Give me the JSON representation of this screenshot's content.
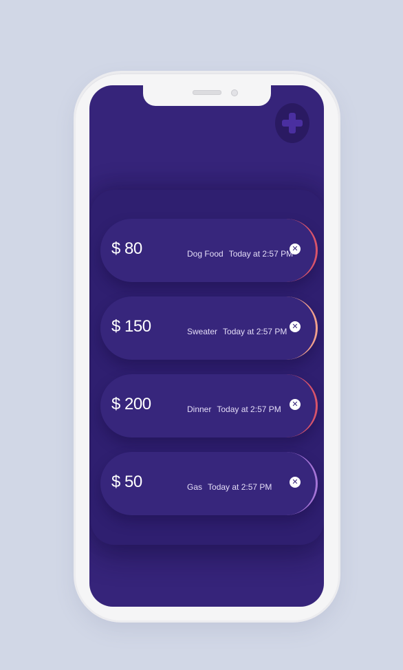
{
  "header": {
    "add_icon": "plus-icon"
  },
  "expenses": [
    {
      "amount": "$ 80",
      "description": "Dog Food",
      "time": "Today at 2:57 PM",
      "accent_color": "#d9546a",
      "remove_icon": "close-icon"
    },
    {
      "amount": "$ 150",
      "description": "Sweater",
      "time": "Today at 2:57 PM",
      "accent_color": "#f0a08c",
      "remove_icon": "close-icon"
    },
    {
      "amount": "$ 200",
      "description": "Dinner",
      "time": "Today at 2:57 PM",
      "accent_color": "#d9546a",
      "remove_icon": "close-icon"
    },
    {
      "amount": "$ 50",
      "description": "Gas",
      "time": "Today at 2:57 PM",
      "accent_color": "#a474d6",
      "remove_icon": "close-icon"
    }
  ],
  "colors": {
    "page_background": "#d1d7e6",
    "screen_background": "#36247a",
    "panel_background": "#2f1f70",
    "card_background": "#37267c"
  }
}
